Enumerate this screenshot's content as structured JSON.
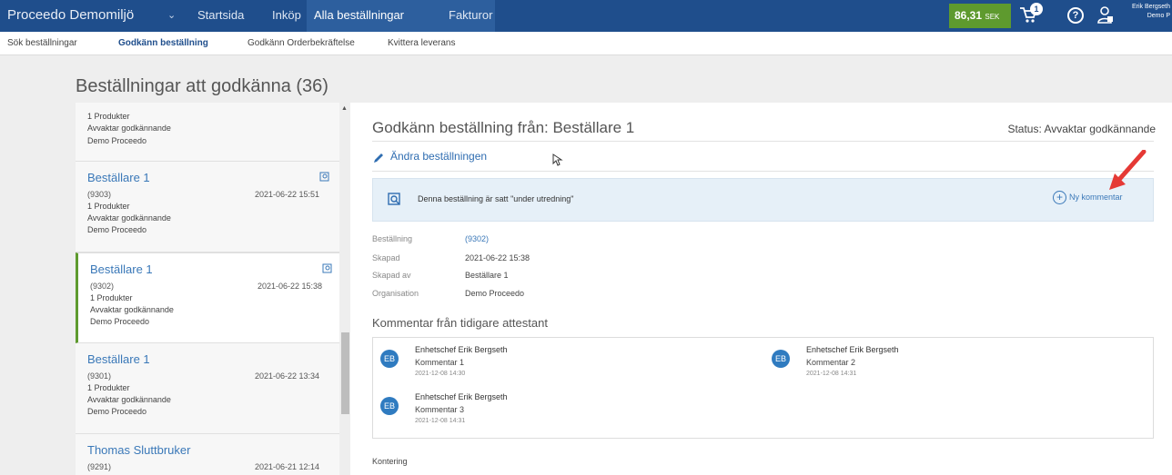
{
  "topbar": {
    "brand": "Proceedo Demomiljö",
    "nav": [
      "Startsida",
      "Inköp",
      "Alla beställningar",
      "Fakturor"
    ],
    "balance_value": "86,31",
    "balance_unit": "SEK",
    "cart_count": "1",
    "user_line1": "Erik Bergseth",
    "user_line2": "Demo P"
  },
  "subnav": [
    "Sök beställningar",
    "Godkänn beställning",
    "Godkänn Orderbekräftelse",
    "Kvittera leverans"
  ],
  "page_title": "Beställningar att godkänna (36)",
  "list": {
    "partial": {
      "products": "1 Produkter",
      "status": "Avvaktar godkännande",
      "org": "Demo Proceedo"
    },
    "cards": [
      {
        "name": "Beställare 1",
        "num": "(9303)",
        "date": "2021-06-22 15:51",
        "products": "1 Produkter",
        "status": "Avvaktar godkännande",
        "org": "Demo Proceedo"
      },
      {
        "name": "Beställare 1",
        "num": "(9302)",
        "date": "2021-06-22 15:38",
        "products": "1 Produkter",
        "status": "Avvaktar godkännande",
        "org": "Demo Proceedo"
      },
      {
        "name": "Beställare 1",
        "num": "(9301)",
        "date": "2021-06-22 13:34",
        "products": "1 Produkter",
        "status": "Avvaktar godkännande",
        "org": "Demo Proceedo"
      },
      {
        "name": "Thomas Sluttbruker",
        "num": "(9291)",
        "date": "2021-06-21 12:14"
      }
    ]
  },
  "detail": {
    "title": "Godkänn beställning från: Beställare 1",
    "status": "Status: Avvaktar godkännande",
    "edit_label": "Ändra beställningen",
    "info_text": "Denna beställning är satt \"under utredning\"",
    "new_comment": "Ny kommentar",
    "fields": [
      {
        "key": "Beställning",
        "value": "(9302)"
      },
      {
        "key": "Skapad",
        "value": "2021-06-22 15:38"
      },
      {
        "key": "Skapad av",
        "value": "Beställare 1"
      },
      {
        "key": "Organisation",
        "value": "Demo Proceedo"
      }
    ],
    "comments_title": "Kommentar från tidigare attestant",
    "comments": [
      {
        "initials": "EB",
        "who": "Enhetschef Erik Bergseth",
        "text": "Kommentar 1",
        "when": "2021-12-08 14:30"
      },
      {
        "initials": "EB",
        "who": "Enhetschef Erik Bergseth",
        "text": "Kommentar 2",
        "when": "2021-12-08 14:31"
      },
      {
        "initials": "EB",
        "who": "Enhetschef Erik Bergseth",
        "text": "Kommentar 3",
        "when": "2021-12-08 14:31"
      }
    ],
    "kontering": "Kontering"
  },
  "colors": {
    "topbar": "#1f4e8c",
    "accent": "#5e9a2e",
    "link": "#3a78b8",
    "arrow": "#e53935"
  }
}
